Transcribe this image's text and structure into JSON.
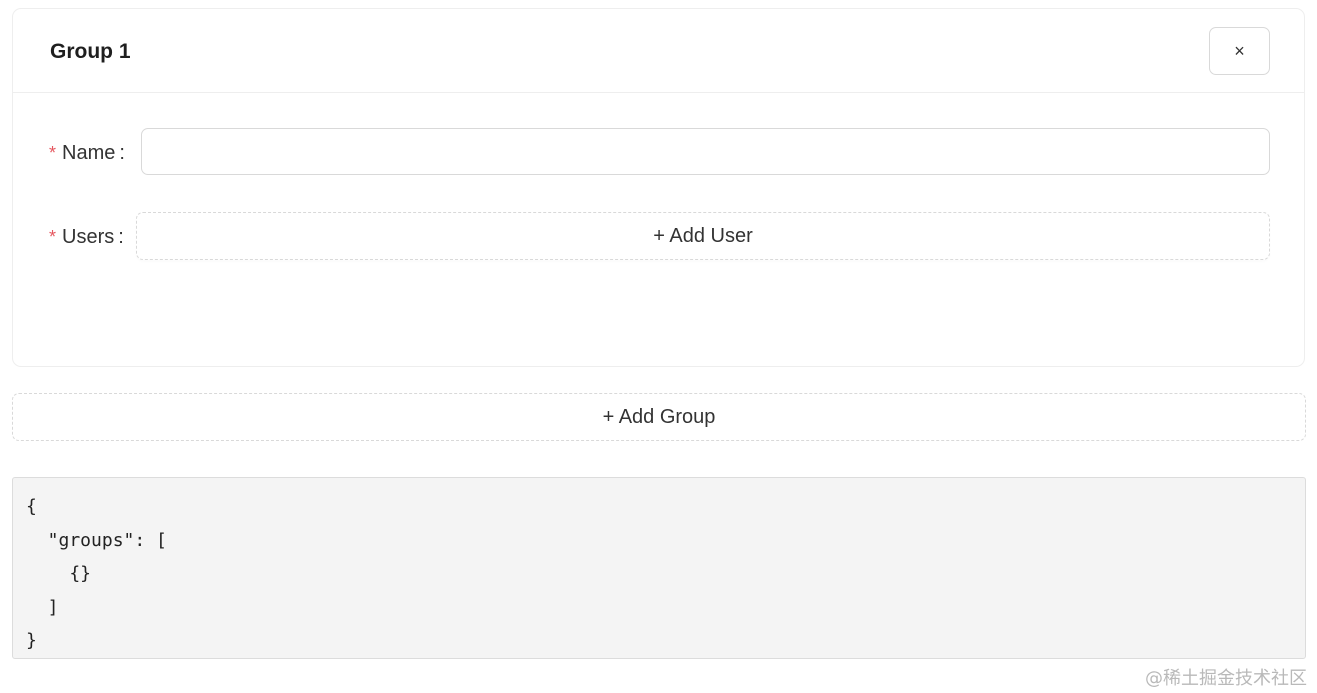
{
  "group_card": {
    "title": "Group 1",
    "close_label": "×",
    "name_field": {
      "required_mark": "*",
      "label": "Name",
      "colon": ":",
      "value": "",
      "placeholder": ""
    },
    "users_field": {
      "required_mark": "*",
      "label": "Users",
      "colon": ":",
      "add_label": "+ Add User"
    }
  },
  "add_group_label": "+ Add Group",
  "json_preview": "{\n  \"groups\": [\n    {}\n  ]\n}",
  "watermark": "@稀土掘金技术社区",
  "colors": {
    "required": "#e5575f",
    "border": "#d9d9d9",
    "code_background": "#f4f4f4"
  }
}
